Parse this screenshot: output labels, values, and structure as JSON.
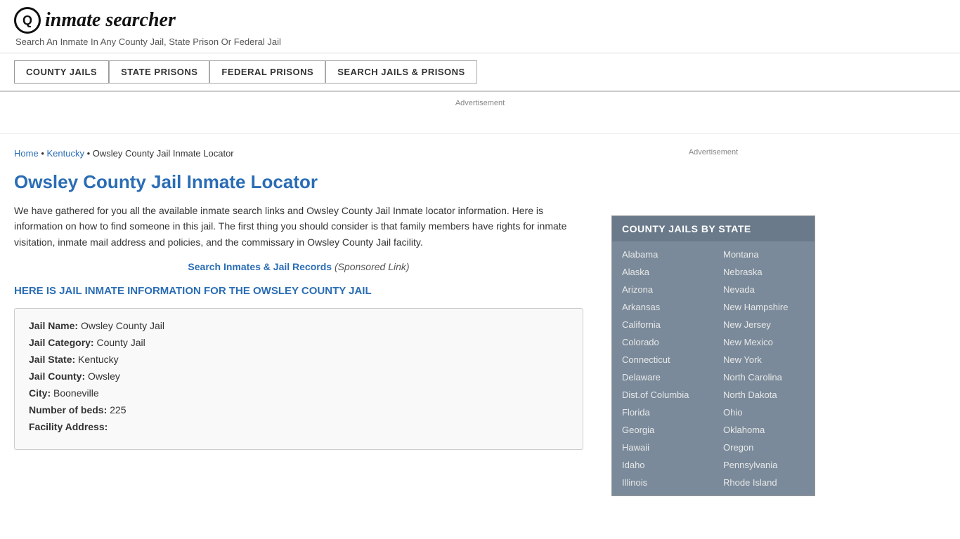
{
  "header": {
    "logo_icon": "Q",
    "logo_text": "inmate searcher",
    "tagline": "Search An Inmate In Any County Jail, State Prison Or Federal Jail"
  },
  "nav": {
    "buttons": [
      {
        "label": "COUNTY JAILS",
        "active": true
      },
      {
        "label": "STATE PRISONS",
        "active": false
      },
      {
        "label": "FEDERAL PRISONS",
        "active": false
      },
      {
        "label": "SEARCH JAILS & PRISONS",
        "active": false
      }
    ]
  },
  "ad_label": "Advertisement",
  "breadcrumb": {
    "home": "Home",
    "state": "Kentucky",
    "current": "Owsley County Jail Inmate Locator"
  },
  "page_title": "Owsley County Jail Inmate Locator",
  "description": "We have gathered for you all the available inmate search links and Owsley County Jail Inmate locator information. Here is information on how to find someone in this jail. The first thing you should consider is that family members have rights for inmate visitation, inmate mail address and policies, and the commissary in Owsley County Jail facility.",
  "sponsored": {
    "link_text": "Search Inmates & Jail Records",
    "label": "(Sponsored Link)"
  },
  "section_heading": "HERE IS JAIL INMATE INFORMATION FOR THE OWSLEY COUNTY JAIL",
  "info": {
    "jail_name_label": "Jail Name:",
    "jail_name_value": "Owsley County Jail",
    "jail_category_label": "Jail Category:",
    "jail_category_value": "County Jail",
    "jail_state_label": "Jail State:",
    "jail_state_value": "Kentucky",
    "jail_county_label": "Jail County:",
    "jail_county_value": "Owsley",
    "city_label": "City:",
    "city_value": "Booneville",
    "beds_label": "Number of beds:",
    "beds_value": "225",
    "address_label": "Facility Address:"
  },
  "sidebar_ad_label": "Advertisement",
  "state_box": {
    "title": "COUNTY JAILS BY STATE",
    "states_left": [
      "Alabama",
      "Alaska",
      "Arizona",
      "Arkansas",
      "California",
      "Colorado",
      "Connecticut",
      "Delaware",
      "Dist.of Columbia",
      "Florida",
      "Georgia",
      "Hawaii",
      "Idaho",
      "Illinois"
    ],
    "states_right": [
      "Montana",
      "Nebraska",
      "Nevada",
      "New Hampshire",
      "New Jersey",
      "New Mexico",
      "New York",
      "North Carolina",
      "North Dakota",
      "Ohio",
      "Oklahoma",
      "Oregon",
      "Pennsylvania",
      "Rhode Island"
    ]
  }
}
